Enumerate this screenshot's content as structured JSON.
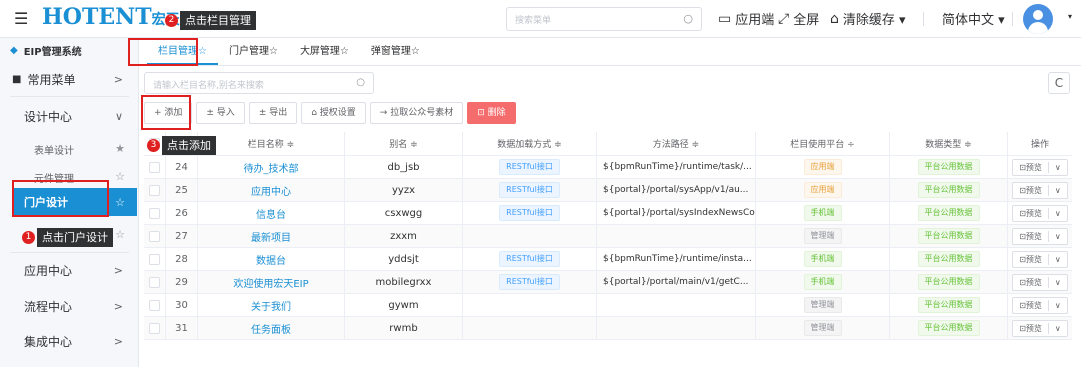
{
  "header": {
    "logo_main": "HOTENT",
    "logo_cn": "宏天",
    "step2_num": "2",
    "step2_tip": "点击栏目管理",
    "search_placeholder": "搜索菜单",
    "actions": [
      {
        "icon": "desktop-icon",
        "label": "应用端"
      },
      {
        "icon": "fullscreen-icon",
        "label": "全屏"
      },
      {
        "icon": "clear-cache-icon",
        "label": "清除缓存 ▾"
      },
      {
        "icon": "",
        "label": "简体中文 ▾"
      }
    ]
  },
  "sidebar": {
    "system_title": "EIP管理系统",
    "items": [
      {
        "label": "常用菜单",
        "arrow": ">"
      },
      {
        "label": "设计中心",
        "arrow": "∨"
      },
      {
        "label": "表单设计",
        "star": "★"
      },
      {
        "label": "元件管理",
        "star": "☆"
      },
      {
        "label": "门户设计",
        "star": "☆"
      },
      {
        "label": "☆",
        "star": "☆"
      },
      {
        "label": "应用中心",
        "arrow": ">"
      },
      {
        "label": "流程中心",
        "arrow": ">"
      },
      {
        "label": "集成中心",
        "arrow": ">"
      }
    ],
    "step1_num": "1",
    "step1_tip": "点击门户设计"
  },
  "tabs": [
    {
      "label": "栏目管理☆",
      "active": true
    },
    {
      "label": "门户管理☆",
      "active": false
    },
    {
      "label": "大屏管理☆",
      "active": false
    },
    {
      "label": "弹窗管理☆",
      "active": false
    }
  ],
  "content": {
    "search_placeholder": "请输入栏目名称,别名来搜索",
    "refresh_icon": "C",
    "toolbar": [
      "+ 添加",
      "± 导入",
      "± 导出",
      "⌂ 授权设置",
      "→ 拉取公众号素材",
      "⊡ 删除"
    ],
    "step3_num": "3",
    "step3_tip": "点击添加"
  },
  "table": {
    "headers": [
      "",
      "",
      "栏目名称 ≑",
      "别名 ≑",
      "数据加载方式 ≑",
      "方法路径 ≑",
      "栏目使用平台 ÷",
      "数据类型 ≑",
      "操作"
    ],
    "op_label": "⊡预览",
    "op_more": "∨",
    "rows": [
      {
        "id": "24",
        "name": "待办_技术部",
        "alias": "db_jsb",
        "load": "RESTful接口",
        "path": "${bpmRunTime}/runtime/task/...",
        "platform": "应用端",
        "ptype": "orange",
        "dtype": "平台公用数据"
      },
      {
        "id": "25",
        "name": "应用中心",
        "alias": "yyzx",
        "load": "RESTful接口",
        "path": "${portal}/portal/sysApp/v1/au...",
        "platform": "应用端",
        "ptype": "orange",
        "dtype": "平台公用数据"
      },
      {
        "id": "26",
        "name": "信息台",
        "alias": "csxwgg",
        "load": "RESTful接口",
        "path": "${portal}/portal/sysIndexNewsColum...",
        "platform": "手机端",
        "ptype": "green",
        "dtype": "平台公用数据"
      },
      {
        "id": "27",
        "name": "最新项目",
        "alias": "zxxm",
        "load": "",
        "path": "",
        "platform": "管理端",
        "ptype": "gray",
        "dtype": "平台公用数据"
      },
      {
        "id": "28",
        "name": "数据台",
        "alias": "yddsjt",
        "load": "RESTful接口",
        "path": "${bpmRunTime}/runtime/insta...",
        "platform": "手机端",
        "ptype": "green",
        "dtype": "平台公用数据"
      },
      {
        "id": "29",
        "name": "欢迎使用宏天EIP",
        "alias": "mobilegrxx",
        "load": "RESTful接口",
        "path": "${portal}/portal/main/v1/getC...",
        "platform": "手机端",
        "ptype": "green",
        "dtype": "平台公用数据"
      },
      {
        "id": "30",
        "name": "关于我们",
        "alias": "gywm",
        "load": "",
        "path": "",
        "platform": "管理端",
        "ptype": "gray",
        "dtype": "平台公用数据"
      },
      {
        "id": "31",
        "name": "任务面板",
        "alias": "rwmb",
        "load": "",
        "path": "",
        "platform": "管理端",
        "ptype": "gray",
        "dtype": "平台公用数据"
      }
    ]
  }
}
